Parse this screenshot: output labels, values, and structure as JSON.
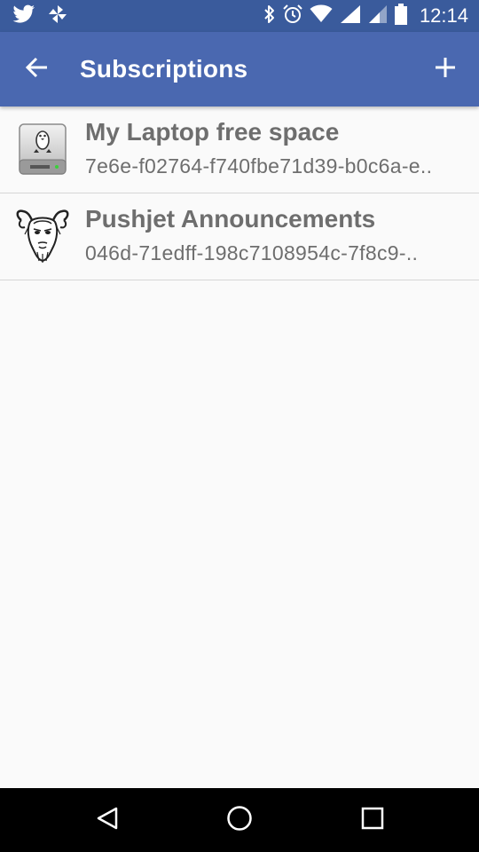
{
  "status_bar": {
    "time": "12:14",
    "left_icons": [
      "twitter-icon",
      "pinwheel-icon"
    ],
    "right_icons": [
      "bluetooth-icon",
      "alarm-icon",
      "wifi-icon",
      "signal-icon",
      "signal-icon",
      "battery-icon"
    ],
    "background": "#3a5b9c"
  },
  "app_bar": {
    "title": "Subscriptions",
    "back_icon": "arrow-back-icon",
    "add_icon": "plus-icon",
    "background": "#4a68b0"
  },
  "subscriptions": [
    {
      "title": "My Laptop free space",
      "token": "7e6e-f02764-f740fbe71d39-b0c6a-e..",
      "icon": "laptop-drive-icon"
    },
    {
      "title": "Pushjet Announcements",
      "token": "046d-71edff-198c7108954c-7f8c9-..",
      "icon": "gnu-head-icon"
    }
  ],
  "nav_bar": {
    "buttons": [
      "back-triangle-icon",
      "home-circle-icon",
      "recents-square-icon"
    ]
  }
}
